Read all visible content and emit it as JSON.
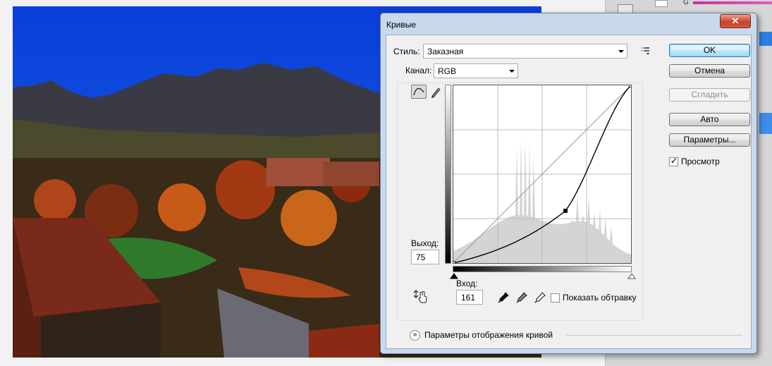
{
  "dialog": {
    "title": "Кривые",
    "close_label": "✕"
  },
  "style": {
    "label": "Стиль:",
    "value": "Заказная"
  },
  "channel": {
    "label": "Канал:",
    "value": "RGB"
  },
  "buttons": {
    "ok": "OK",
    "cancel": "Отмена",
    "smooth": "Сгладить",
    "auto": "Авто",
    "options": "Параметры..."
  },
  "preview": {
    "label": "Просмотр",
    "checked": true
  },
  "output": {
    "label": "Выход:",
    "value": "75"
  },
  "input": {
    "label": "Вход:",
    "value": "161"
  },
  "show_clipping": {
    "label": "Показать обтравку",
    "checked": false
  },
  "curve_display_options": {
    "label": "Параметры отображения кривой"
  },
  "right_panel": {
    "channel_letter": "G"
  },
  "curve": {
    "points": [
      [
        0,
        0
      ],
      [
        161,
        75
      ],
      [
        255,
        255
      ]
    ]
  },
  "icons": {
    "curve_tool": "curve-point-icon",
    "pencil_tool": "pencil-icon",
    "presets_menu": "preset-options-icon",
    "hand_adjust": "on-image-adjust-icon",
    "black_eyedropper": "black-point-eyedropper-icon",
    "gray_eyedropper": "gray-point-eyedropper-icon",
    "white_eyedropper": "white-point-eyedropper-icon"
  },
  "colors": {
    "title_bar": "#c8d9ee",
    "close_button": "#c8452a",
    "sky": "#0a40d8"
  }
}
